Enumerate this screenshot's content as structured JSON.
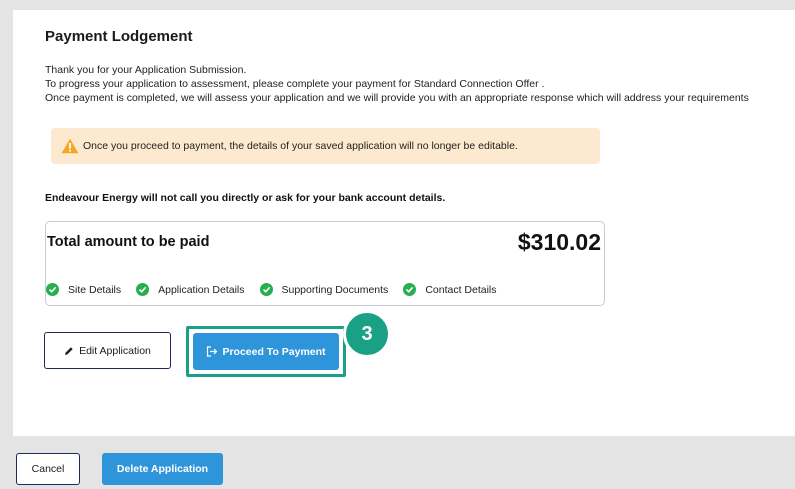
{
  "page": {
    "title": "Payment Lodgement",
    "intro_lines": [
      "Thank you for your Application Submission.",
      "To progress your application to assessment, please complete your payment for Standard Connection Offer .",
      "Once payment is completed, we will assess your application and we will provide you with an appropriate response which will address your requirements"
    ],
    "warning": "Once you proceed to payment, the details of your saved application will no longer be editable.",
    "notice": "Endeavour Energy will not call you directly or ask for your bank account details."
  },
  "summary": {
    "label": "Total amount to be paid",
    "amount": "$310.02",
    "steps": [
      {
        "label": "Site Details",
        "icon": "check-circle-icon"
      },
      {
        "label": "Application Details",
        "icon": "check-circle-icon"
      },
      {
        "label": "Supporting Documents",
        "icon": "check-circle-icon"
      },
      {
        "label": "Contact Details",
        "icon": "check-circle-icon"
      }
    ]
  },
  "actions": {
    "edit_label": "Edit Application",
    "proceed_label": "Proceed To Payment",
    "step_number": "3"
  },
  "footer": {
    "cancel_label": "Cancel",
    "delete_label": "Delete Application"
  },
  "colors": {
    "primary": "#2f95da",
    "highlight": "#1aa085",
    "success": "#27ae4f",
    "warning_bg": "#fde9cf",
    "warning_icon": "#f5a623",
    "outline": "#1e2a5e"
  }
}
